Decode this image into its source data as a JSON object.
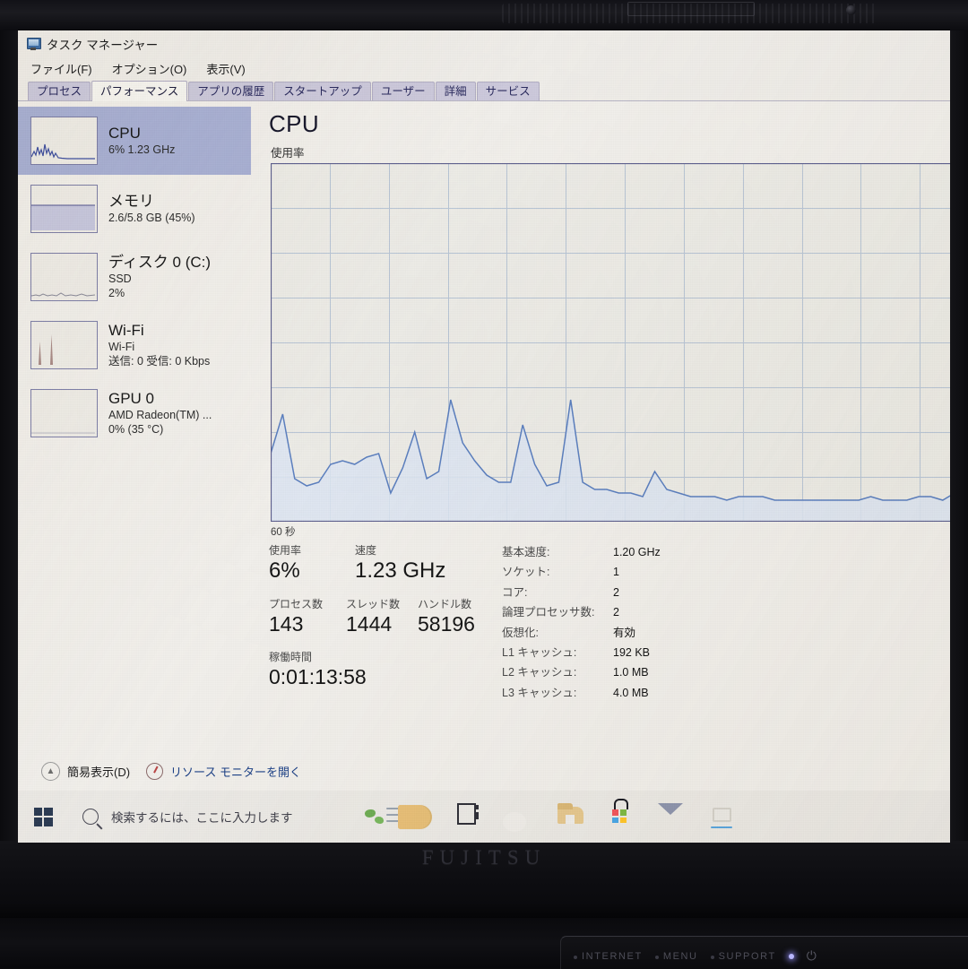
{
  "window": {
    "title": "タスク マネージャー",
    "icon": "task-manager-icon",
    "menus": [
      "ファイル(F)",
      "オプション(O)",
      "表示(V)"
    ],
    "tabs": [
      {
        "label": "プロセス",
        "active": false
      },
      {
        "label": "パフォーマンス",
        "active": true
      },
      {
        "label": "アプリの履歴",
        "active": false
      },
      {
        "label": "スタートアップ",
        "active": false
      },
      {
        "label": "ユーザー",
        "active": false
      },
      {
        "label": "詳細",
        "active": false
      },
      {
        "label": "サービス",
        "active": false
      }
    ]
  },
  "sidebar": {
    "items": [
      {
        "name": "CPU",
        "line1": "6%  1.23 GHz",
        "line2": "",
        "selected": true
      },
      {
        "name": "メモリ",
        "line1": "2.6/5.8 GB (45%)",
        "line2": "",
        "selected": false
      },
      {
        "name": "ディスク 0 (C:)",
        "line1": "SSD",
        "line2": "2%",
        "selected": false
      },
      {
        "name": "Wi-Fi",
        "line1": "Wi-Fi",
        "line2": "送信: 0 受信: 0 Kbps",
        "selected": false
      },
      {
        "name": "GPU 0",
        "line1": "AMD Radeon(TM) ...",
        "line2": "0%  (35 °C)",
        "selected": false
      }
    ]
  },
  "main": {
    "heading": "CPU",
    "chart_caption": "使用率",
    "axis_left": "60 秒",
    "axis_max": "100%",
    "axis_min": "0"
  },
  "stats": {
    "utilization_label": "使用率",
    "utilization_value": "6%",
    "speed_label": "速度",
    "speed_value": "1.23 GHz",
    "processes_label": "プロセス数",
    "processes_value": "143",
    "threads_label": "スレッド数",
    "threads_value": "1444",
    "handles_label": "ハンドル数",
    "handles_value": "58196",
    "uptime_label": "稼働時間",
    "uptime_value": "0:01:13:58"
  },
  "specs": [
    {
      "key": "基本速度:",
      "value": "1.20 GHz"
    },
    {
      "key": "ソケット:",
      "value": "1"
    },
    {
      "key": "コア:",
      "value": "2"
    },
    {
      "key": "論理プロセッサ数:",
      "value": "2"
    },
    {
      "key": "仮想化:",
      "value": "有効"
    },
    {
      "key": "L1 キャッシュ:",
      "value": "192 KB"
    },
    {
      "key": "L2 キャッシュ:",
      "value": "1.0 MB"
    },
    {
      "key": "L3 キャッシュ:",
      "value": "4.0 MB"
    }
  ],
  "statusbar": {
    "simple_view": "簡易表示(D)",
    "resource_monitor": "リソース モニターを開く"
  },
  "taskbar": {
    "start": "start-button",
    "search_placeholder": "検索するには、ここに入力します",
    "icons": [
      "news-weather-icon",
      "task-view-icon",
      "edge-icon",
      "file-explorer-icon",
      "microsoft-store-icon",
      "mail-icon",
      "inactive-app-icon"
    ]
  },
  "laptop": {
    "brand": "FUJITSU",
    "hotkeys": [
      "INTERNET",
      "MENU",
      "SUPPORT"
    ],
    "power_glyph": "⏻"
  },
  "colors": {
    "accent": "#a9b1d5",
    "graph_line": "#5b7fc0",
    "graph_fill": "#dde6f3",
    "link": "#1a3f86",
    "window_bg": "#f0eeea"
  },
  "chart_data": {
    "type": "area",
    "title": "CPU 使用率",
    "xlabel": "60 秒",
    "ylabel": "使用率",
    "ylim": [
      0,
      100
    ],
    "grid": true,
    "legend": "none",
    "series": [
      {
        "name": "CPU 使用率 (%)",
        "values": [
          19,
          30,
          12,
          10,
          11,
          16,
          17,
          16,
          18,
          19,
          8,
          15,
          25,
          12,
          14,
          34,
          22,
          17,
          13,
          11,
          11,
          27,
          16,
          10,
          11,
          34,
          11,
          9,
          9,
          8,
          8,
          7,
          14,
          9,
          8,
          7,
          7,
          7,
          6,
          7,
          7,
          7,
          6,
          6,
          6,
          6,
          6,
          6,
          6,
          6,
          7,
          6,
          6,
          6,
          7,
          7,
          6,
          8,
          7,
          6
        ]
      }
    ]
  }
}
